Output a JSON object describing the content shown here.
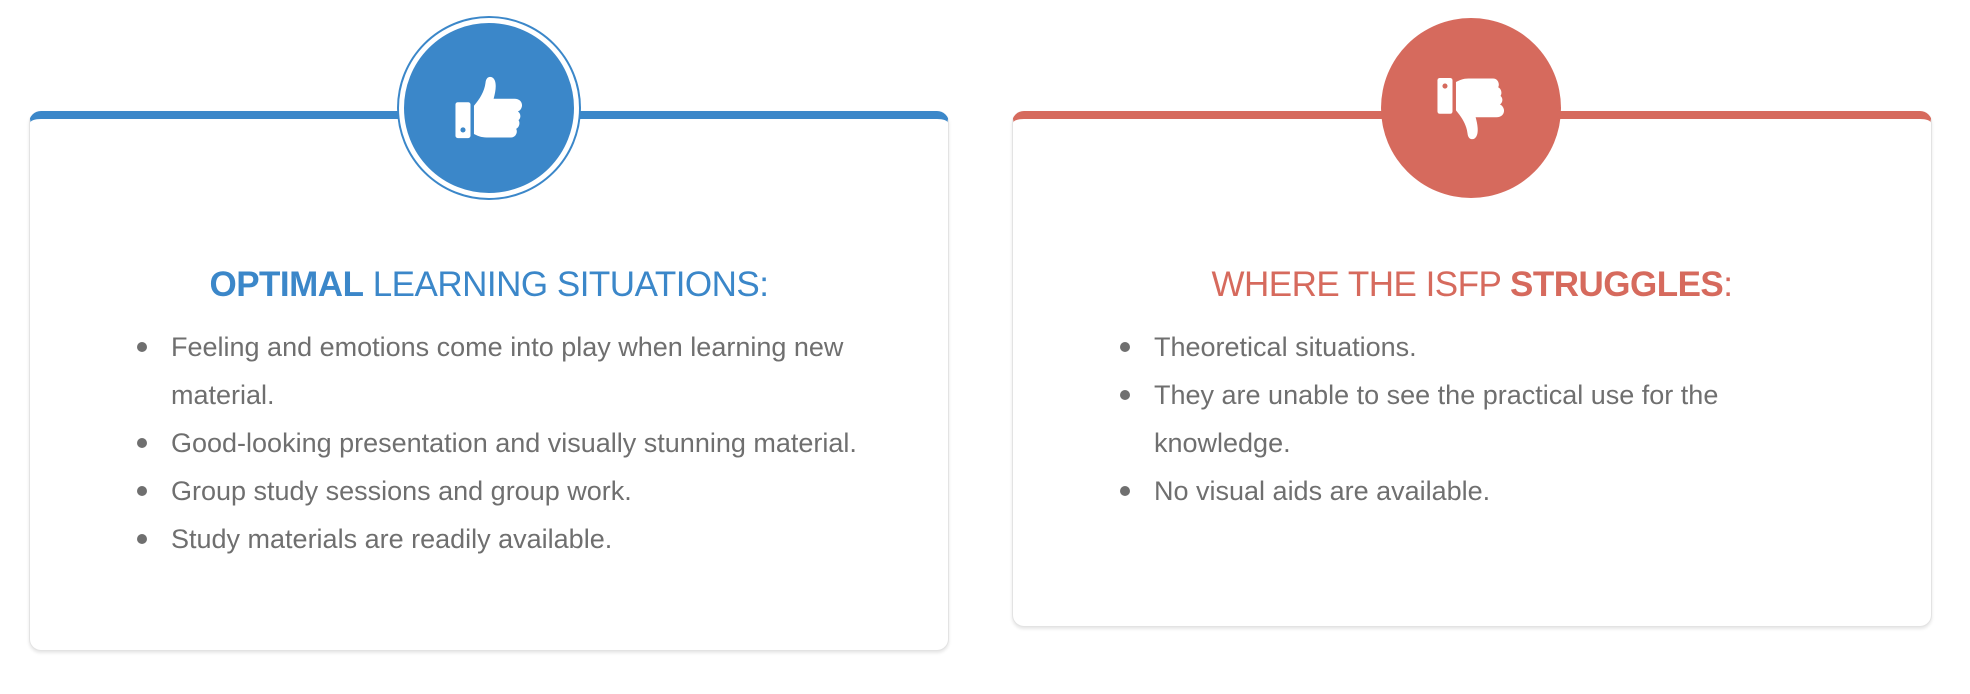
{
  "colors": {
    "positive": "#3b87c9",
    "negative": "#d66a5d",
    "text": "#6f6f6f"
  },
  "positive_card": {
    "icon": "thumbs-up-icon",
    "title_bold": "OPTIMAL",
    "title_rest": " LEARNING SITUATIONS:",
    "items": [
      "Feeling and emotions come into play when learning new material.",
      "Good-looking presentation and visually stunning material.",
      "Group study sessions and group work.",
      "Study materials are readily available."
    ]
  },
  "negative_card": {
    "icon": "thumbs-down-icon",
    "title_rest": "WHERE THE ISFP ",
    "title_bold": "STRUGGLES",
    "title_suffix": ":",
    "items": [
      "Theoretical situations.",
      "They are unable to see the practical use for the knowledge.",
      "No visual aids are available."
    ]
  }
}
